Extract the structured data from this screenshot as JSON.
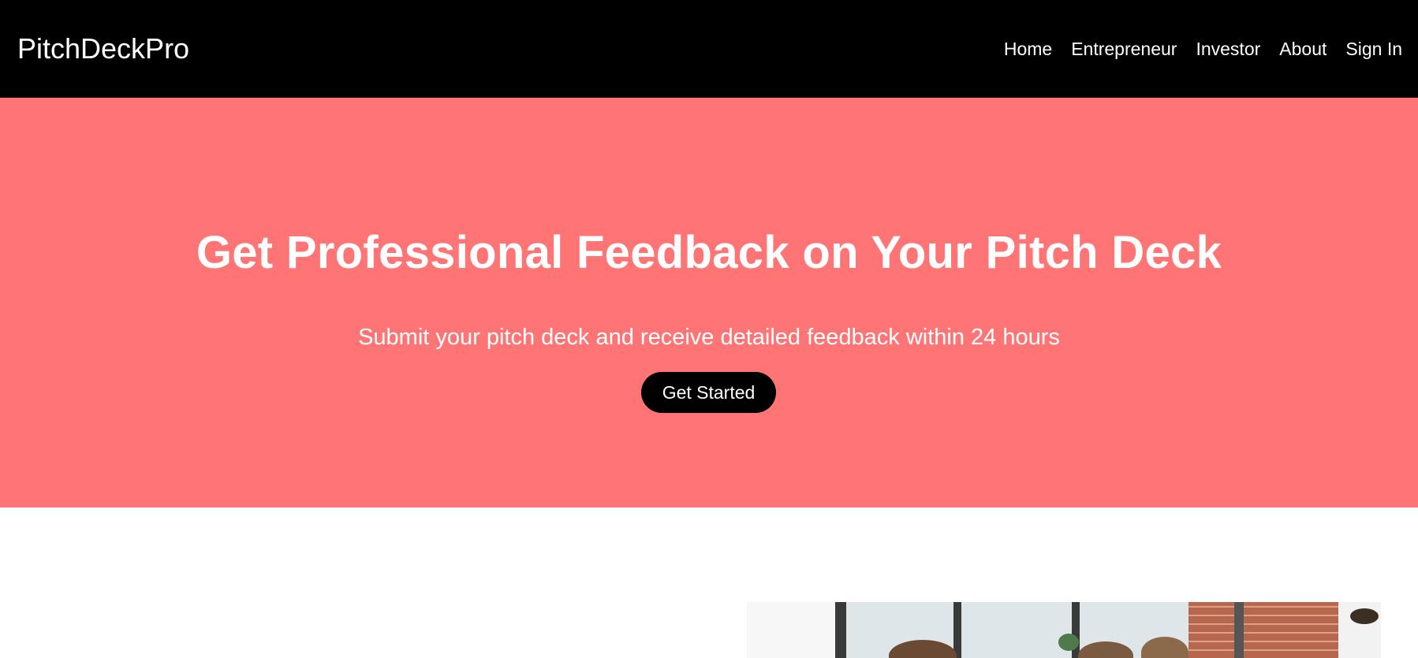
{
  "navbar": {
    "brand": "PitchDeckPro",
    "links": [
      {
        "label": "Home"
      },
      {
        "label": "Entrepreneur"
      },
      {
        "label": "Investor"
      },
      {
        "label": "About"
      },
      {
        "label": "Sign In"
      }
    ]
  },
  "hero": {
    "title": "Get Professional Feedback on Your Pitch Deck",
    "subtitle": "Submit your pitch deck and receive detailed feedback within 24 hours",
    "cta_label": "Get Started"
  },
  "colors": {
    "navbar_bg": "#000000",
    "hero_bg": "#ff7474",
    "cta_bg": "#000000",
    "text_light": "#ffffff"
  }
}
